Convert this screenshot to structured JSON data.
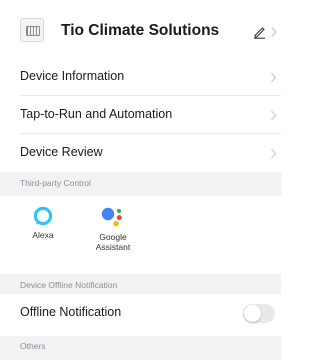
{
  "header": {
    "title": "Tio Climate Solutions",
    "edit_icon": "pencil-icon",
    "chevron_icon": "chevron-right-icon"
  },
  "menu": [
    {
      "label": "Device Information"
    },
    {
      "label": "Tap-to-Run and Automation"
    },
    {
      "label": "Device Review"
    }
  ],
  "third_party": {
    "section_title": "Third-party Control",
    "items": [
      {
        "label": "Alexa",
        "icon": "alexa-icon"
      },
      {
        "label": "Google\nAssistant",
        "icon": "google-assistant-icon"
      }
    ]
  },
  "offline": {
    "section_title": "Device Offline Notification",
    "label": "Offline Notification",
    "enabled": false
  },
  "others": {
    "section_title": "Others"
  },
  "colors": {
    "alexa": "#31c4f3",
    "google_blue": "#4285f4",
    "google_red": "#ea4335",
    "google_yellow": "#fbbc05",
    "google_green": "#34a853",
    "section_bg": "#f2f2f4"
  }
}
